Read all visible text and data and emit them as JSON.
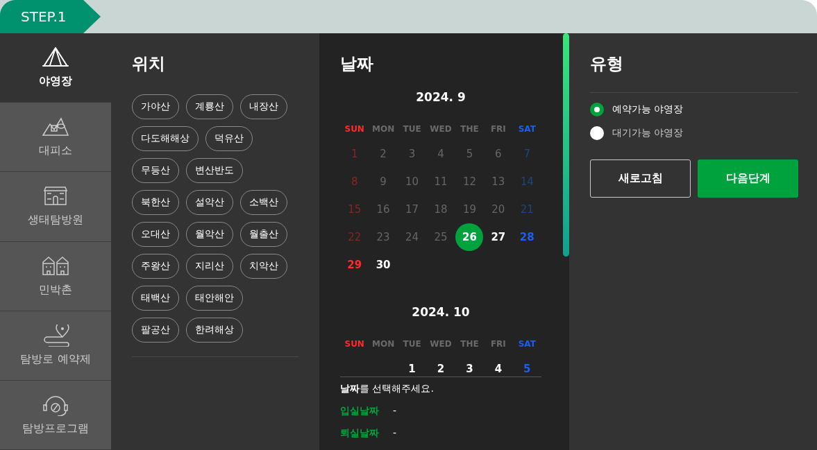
{
  "step": "STEP.1",
  "sidebar": {
    "items": [
      {
        "label": "야영장",
        "selected": true
      },
      {
        "label": "대피소",
        "selected": false
      },
      {
        "label": "생태탐방원",
        "selected": false
      },
      {
        "label": "민박촌",
        "selected": false
      },
      {
        "label": "탐방로 예약제",
        "selected": false
      },
      {
        "label": "탐방프로그램",
        "selected": false
      }
    ]
  },
  "location": {
    "title": "위치",
    "rows": [
      [
        "가야산",
        "계룡산",
        "내장산"
      ],
      [
        "다도해해상",
        "덕유산"
      ],
      [
        "무등산",
        "변산반도"
      ],
      [
        "북한산",
        "설악산",
        "소백산"
      ],
      [
        "오대산",
        "월악산",
        "월출산"
      ],
      [
        "주왕산",
        "지리산",
        "치악산"
      ],
      [
        "태백산",
        "태안해안"
      ],
      [
        "팔공산",
        "한려해상"
      ]
    ]
  },
  "date": {
    "title": "날짜",
    "months": [
      {
        "title": "2024. 9",
        "weekdays": [
          "SUN",
          "MON",
          "TUE",
          "WED",
          "THE",
          "FRI",
          "SAT"
        ],
        "weeks": [
          [
            {
              "day": "1",
              "available": false,
              "selected": false
            },
            {
              "day": "2",
              "available": false,
              "selected": false
            },
            {
              "day": "3",
              "available": false,
              "selected": false
            },
            {
              "day": "4",
              "available": false,
              "selected": false
            },
            {
              "day": "5",
              "available": false,
              "selected": false
            },
            {
              "day": "6",
              "available": false,
              "selected": false
            },
            {
              "day": "7",
              "available": false,
              "selected": false
            }
          ],
          [
            {
              "day": "8",
              "available": false,
              "selected": false
            },
            {
              "day": "9",
              "available": false,
              "selected": false
            },
            {
              "day": "10",
              "available": false,
              "selected": false
            },
            {
              "day": "11",
              "available": false,
              "selected": false
            },
            {
              "day": "12",
              "available": false,
              "selected": false
            },
            {
              "day": "13",
              "available": false,
              "selected": false
            },
            {
              "day": "14",
              "available": false,
              "selected": false
            }
          ],
          [
            {
              "day": "15",
              "available": false,
              "selected": false
            },
            {
              "day": "16",
              "available": false,
              "selected": false
            },
            {
              "day": "17",
              "available": false,
              "selected": false
            },
            {
              "day": "18",
              "available": false,
              "selected": false
            },
            {
              "day": "19",
              "available": false,
              "selected": false
            },
            {
              "day": "20",
              "available": false,
              "selected": false
            },
            {
              "day": "21",
              "available": false,
              "selected": false
            }
          ],
          [
            {
              "day": "22",
              "available": false,
              "selected": false
            },
            {
              "day": "23",
              "available": false,
              "selected": false
            },
            {
              "day": "24",
              "available": false,
              "selected": false
            },
            {
              "day": "25",
              "available": false,
              "selected": false
            },
            {
              "day": "26",
              "available": true,
              "selected": true
            },
            {
              "day": "27",
              "available": true,
              "selected": false
            },
            {
              "day": "28",
              "available": true,
              "selected": false
            }
          ],
          [
            {
              "day": "29",
              "available": true,
              "selected": false
            },
            {
              "day": "30",
              "available": true,
              "selected": false
            }
          ]
        ]
      },
      {
        "title": "2024. 10",
        "weekdays": [
          "SUN",
          "MON",
          "TUE",
          "WED",
          "THE",
          "FRI",
          "SAT"
        ],
        "weeks": [
          [
            {
              "kind": "blank"
            },
            {
              "kind": "blank"
            },
            {
              "day": "1",
              "available": true,
              "selected": false
            },
            {
              "day": "2",
              "available": true,
              "selected": false
            },
            {
              "day": "3",
              "available": true,
              "selected": false
            },
            {
              "day": "4",
              "available": true,
              "selected": false
            },
            {
              "day": "5",
              "available": true,
              "selected": false
            }
          ]
        ]
      }
    ],
    "prompt": "**날짜**를 선택해주세요.",
    "fields": [
      {
        "label": "입실날짜",
        "value": "-"
      },
      {
        "label": "퇴실날짜",
        "value": "-"
      }
    ]
  },
  "type": {
    "title": "유형",
    "options": [
      {
        "label": "예약가능 야영장",
        "selected": true
      },
      {
        "label": "대기가능 야영장",
        "selected": false
      }
    ],
    "buttons": [
      {
        "label": "새로고침",
        "kind": "outline"
      },
      {
        "label": "다음단계",
        "kind": "primary"
      }
    ]
  }
}
